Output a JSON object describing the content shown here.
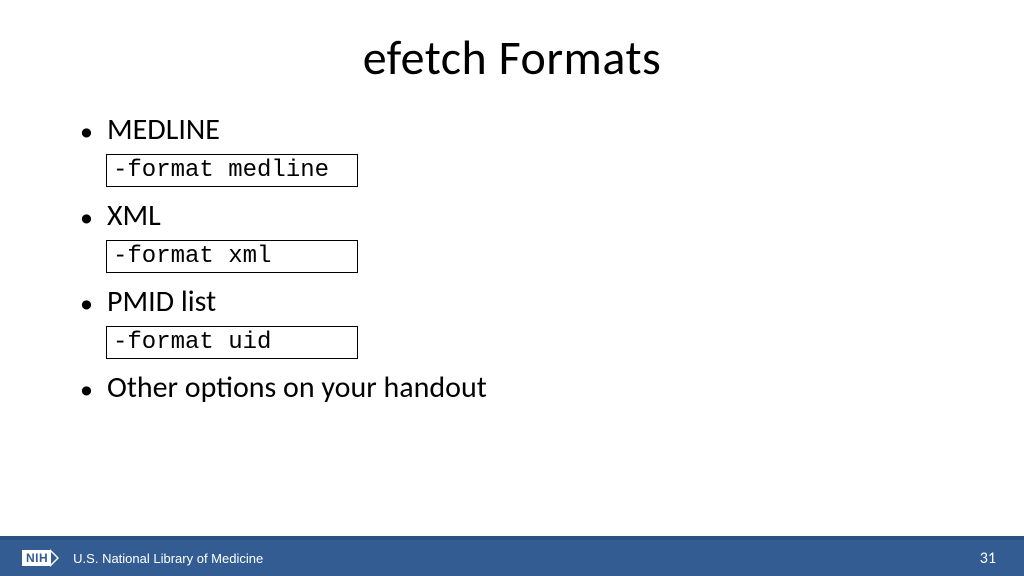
{
  "title": "efetch Formats",
  "bullets": [
    {
      "label": "MEDLINE",
      "code": "-format medline"
    },
    {
      "label": "XML",
      "code": "-format xml"
    },
    {
      "label": "PMID list",
      "code": "-format uid"
    },
    {
      "label": "Other options on your handout",
      "code": null
    }
  ],
  "footer": {
    "badge": "NIH",
    "org": "U.S. National Library of Medicine",
    "page": "31"
  }
}
